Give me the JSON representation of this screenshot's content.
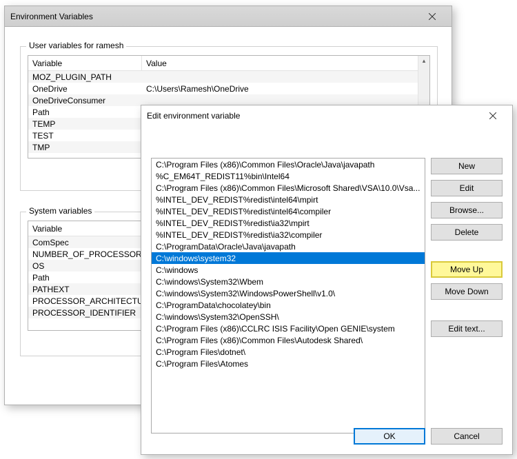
{
  "envWindow": {
    "title": "Environment Variables",
    "userGroup": {
      "label": "User variables for ramesh",
      "colVariable": "Variable",
      "colValue": "Value",
      "rows": [
        {
          "var": "MOZ_PLUGIN_PATH",
          "val": ""
        },
        {
          "var": "OneDrive",
          "val": "C:\\Users\\Ramesh\\OneDrive"
        },
        {
          "var": "OneDriveConsumer",
          "val": ""
        },
        {
          "var": "Path",
          "val": ""
        },
        {
          "var": "TEMP",
          "val": ""
        },
        {
          "var": "TEST",
          "val": ""
        },
        {
          "var": "TMP",
          "val": ""
        }
      ]
    },
    "sysGroup": {
      "label": "System variables",
      "colVariable": "Variable",
      "rows": [
        {
          "var": "ComSpec"
        },
        {
          "var": "NUMBER_OF_PROCESSORS"
        },
        {
          "var": "OS"
        },
        {
          "var": "Path"
        },
        {
          "var": "PATHEXT"
        },
        {
          "var": "PROCESSOR_ARCHITECTURE"
        },
        {
          "var": "PROCESSOR_IDENTIFIER"
        }
      ]
    }
  },
  "editWindow": {
    "title": "Edit environment variable",
    "paths": [
      "C:\\Program Files (x86)\\Common Files\\Oracle\\Java\\javapath",
      "%C_EM64T_REDIST11%bin\\Intel64",
      "C:\\Program Files (x86)\\Common Files\\Microsoft Shared\\VSA\\10.0\\Vsa...",
      "%INTEL_DEV_REDIST%redist\\intel64\\mpirt",
      "%INTEL_DEV_REDIST%redist\\intel64\\compiler",
      "%INTEL_DEV_REDIST%redist\\ia32\\mpirt",
      "%INTEL_DEV_REDIST%redist\\ia32\\compiler",
      "C:\\ProgramData\\Oracle\\Java\\javapath",
      "C:\\windows\\system32",
      "C:\\windows",
      "C:\\windows\\System32\\Wbem",
      "C:\\windows\\System32\\WindowsPowerShell\\v1.0\\",
      "C:\\ProgramData\\chocolatey\\bin",
      "C:\\windows\\System32\\OpenSSH\\",
      "C:\\Program Files (x86)\\CCLRC ISIS Facility\\Open GENIE\\system",
      "C:\\Program Files (x86)\\Common Files\\Autodesk Shared\\",
      "C:\\Program Files\\dotnet\\",
      "C:\\Program Files\\Atomes"
    ],
    "selectedIndex": 8,
    "buttons": {
      "new": "New",
      "edit": "Edit",
      "browse": "Browse...",
      "delete": "Delete",
      "moveUp": "Move Up",
      "moveDown": "Move Down",
      "editText": "Edit text...",
      "ok": "OK",
      "cancel": "Cancel"
    }
  }
}
